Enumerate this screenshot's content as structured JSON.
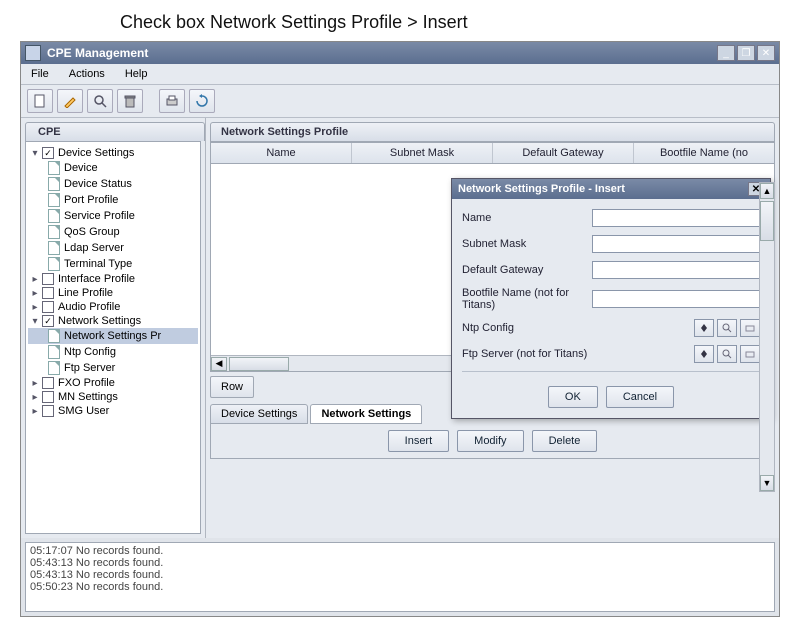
{
  "caption": "Check box Network Settings   Profile  >  Insert",
  "window": {
    "title": "CPE Management",
    "min": "_",
    "restore": "❐",
    "close": "✕"
  },
  "menu": {
    "file": "File",
    "actions": "Actions",
    "help": "Help"
  },
  "toolbar_icons": {
    "new": "new-icon",
    "edit": "edit-icon",
    "search": "search-icon",
    "delete": "delete-icon",
    "print": "print-icon",
    "refresh": "refresh-icon"
  },
  "left_tab": "CPE",
  "tree": [
    {
      "label": "Device Settings",
      "type": "parent",
      "checked": true,
      "expanded": true,
      "children": [
        {
          "label": "Device"
        },
        {
          "label": "Device Status"
        },
        {
          "label": "Port Profile"
        },
        {
          "label": "Service Profile"
        },
        {
          "label": "QoS Group"
        },
        {
          "label": "Ldap Server"
        },
        {
          "label": "Terminal Type"
        }
      ]
    },
    {
      "label": "Interface Profile",
      "type": "closed"
    },
    {
      "label": "Line Profile",
      "type": "closed"
    },
    {
      "label": "Audio Profile",
      "type": "closed"
    },
    {
      "label": "Network Settings",
      "type": "parent",
      "checked": true,
      "expanded": true,
      "children": [
        {
          "label": "Network Settings Pr",
          "selected": true
        },
        {
          "label": "Ntp Config"
        },
        {
          "label": "Ftp Server"
        }
      ]
    },
    {
      "label": "FXO Profile",
      "type": "closed"
    },
    {
      "label": "MN Settings",
      "type": "closed"
    },
    {
      "label": "SMG User",
      "type": "closed"
    }
  ],
  "panel_tab": "Network Settings Profile",
  "table": {
    "headers": [
      "Name",
      "Subnet Mask",
      "Default Gateway",
      "Bootfile Name (no"
    ]
  },
  "row_label": "Row",
  "search_btn": "Show search form",
  "bottom_tabs": {
    "device": "Device Settings",
    "network": "Network Settings"
  },
  "crud": {
    "insert": "Insert",
    "modify": "Modify",
    "delete": "Delete"
  },
  "log": [
    "05:17:07 No records found.",
    "05:43:13 No records found.",
    "05:43:13 No records found.",
    "05:50:23 No records found."
  ],
  "dialog": {
    "title": "Network Settings Profile - Insert",
    "fields": {
      "name": "Name",
      "subnet": "Subnet Mask",
      "gateway": "Default Gateway",
      "bootfile": "Bootfile Name (not for Titans)",
      "ntp": "Ntp Config",
      "ftp": "Ftp Server (not for Titans)"
    },
    "ok": "OK",
    "cancel": "Cancel",
    "lookup": "⚙",
    "search": "🔍",
    "clear": "▭"
  }
}
